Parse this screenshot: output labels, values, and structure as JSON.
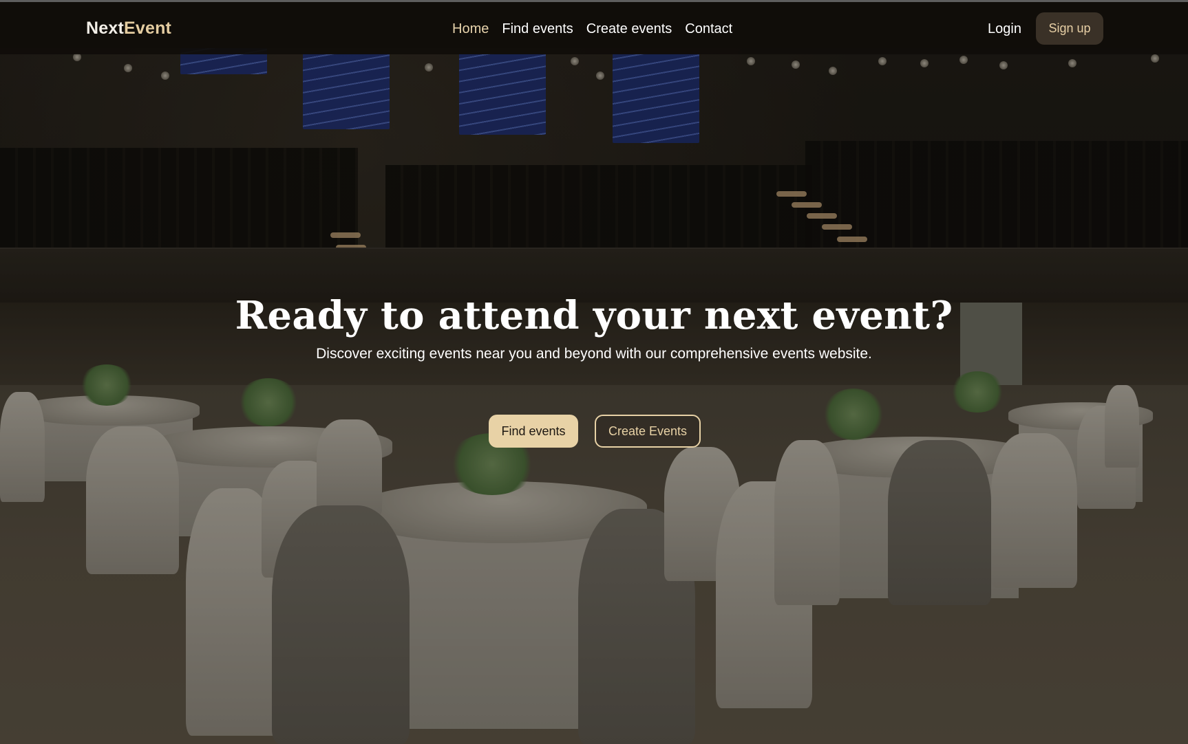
{
  "brand": {
    "prefix": "Next",
    "accent": "Event"
  },
  "nav": {
    "links": [
      {
        "label": "Home",
        "active": true
      },
      {
        "label": "Find events",
        "active": false
      },
      {
        "label": "Create events",
        "active": false
      },
      {
        "label": "Contact",
        "active": false
      }
    ],
    "login_label": "Login",
    "signup_label": "Sign up"
  },
  "hero": {
    "title": "Ready to attend your next event?",
    "subtitle": "Discover exciting events near you and beyond with our comprehensive events website.",
    "primary_cta": "Find events",
    "secondary_cta": "Create Events"
  },
  "colors": {
    "accent": "#e8d2a6",
    "navbar_bg": "#100d0a",
    "signup_bg": "#3a3127"
  }
}
